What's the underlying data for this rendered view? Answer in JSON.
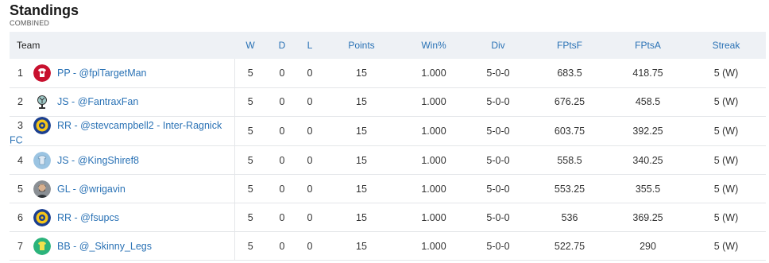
{
  "header": {
    "title": "Standings",
    "subtitle": "COMBINED"
  },
  "columns": [
    "Team",
    "W",
    "D",
    "L",
    "Points",
    "Win%",
    "Div",
    "FPtsF",
    "FPtsA",
    "Streak"
  ],
  "rows": [
    {
      "rank": "1",
      "team": "PP - @fplTargetMan",
      "avatar": "red-white-jersey-icon",
      "w": "5",
      "d": "0",
      "l": "0",
      "points": "15",
      "winpct": "1.000",
      "div": "5-0-0",
      "fptsf": "683.5",
      "fptsa": "418.75",
      "streak": "5 (W)"
    },
    {
      "rank": "2",
      "team": "JS - @FantraxFan",
      "avatar": "fan-icon",
      "w": "5",
      "d": "0",
      "l": "0",
      "points": "15",
      "winpct": "1.000",
      "div": "5-0-0",
      "fptsf": "676.25",
      "fptsa": "458.5",
      "streak": "5 (W)"
    },
    {
      "rank": "3",
      "team": "RR - @stevcampbell2 - Inter-Ragnick FC",
      "avatar": "club-crest-icon",
      "w": "5",
      "d": "0",
      "l": "0",
      "points": "15",
      "winpct": "1.000",
      "div": "5-0-0",
      "fptsf": "603.75",
      "fptsa": "392.25",
      "streak": "5 (W)"
    },
    {
      "rank": "4",
      "team": "JS - @KingShiref8",
      "avatar": "sky-blue-jersey-icon",
      "w": "5",
      "d": "0",
      "l": "0",
      "points": "15",
      "winpct": "1.000",
      "div": "5-0-0",
      "fptsf": "558.5",
      "fptsa": "340.25",
      "streak": "5 (W)"
    },
    {
      "rank": "5",
      "team": "GL - @wrigavin",
      "avatar": "user-photo-icon",
      "w": "5",
      "d": "0",
      "l": "0",
      "points": "15",
      "winpct": "1.000",
      "div": "5-0-0",
      "fptsf": "553.25",
      "fptsa": "355.5",
      "streak": "5 (W)"
    },
    {
      "rank": "6",
      "team": "RR - @fsupcs",
      "avatar": "club-crest-icon",
      "w": "5",
      "d": "0",
      "l": "0",
      "points": "15",
      "winpct": "1.000",
      "div": "5-0-0",
      "fptsf": "536",
      "fptsa": "369.25",
      "streak": "5 (W)"
    },
    {
      "rank": "7",
      "team": "BB - @_Skinny_Legs",
      "avatar": "green-yellow-jersey-icon",
      "w": "5",
      "d": "0",
      "l": "0",
      "points": "15",
      "winpct": "1.000",
      "div": "5-0-0",
      "fptsf": "522.75",
      "fptsa": "290",
      "streak": "5 (W)"
    }
  ],
  "colors": {
    "link": "#2a72b5",
    "header_bg": "#eef1f5",
    "border": "#e4e6e9"
  }
}
